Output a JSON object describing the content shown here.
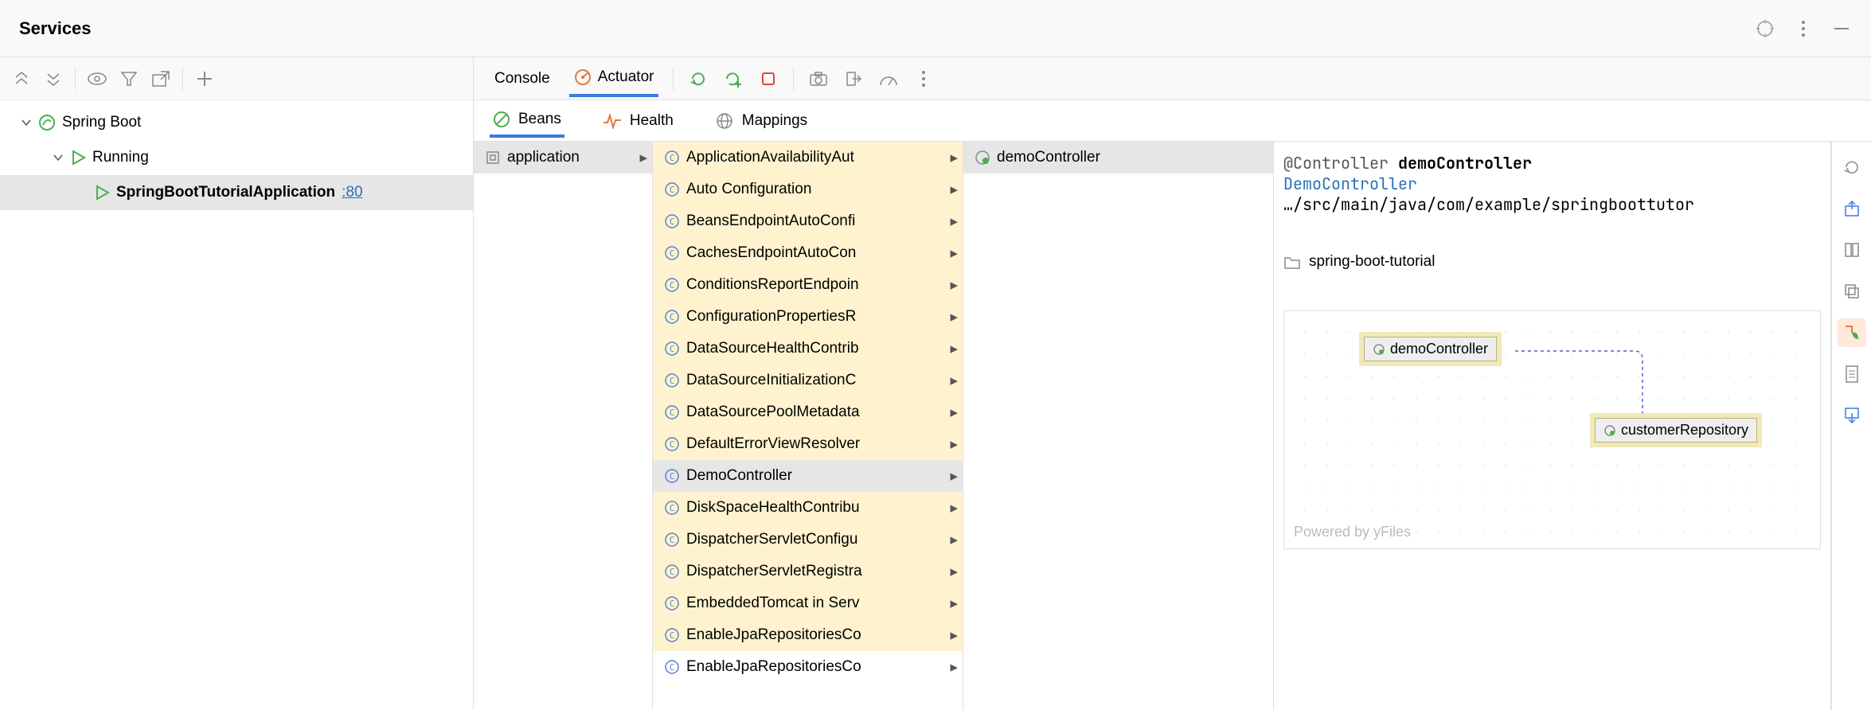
{
  "header": {
    "title": "Services"
  },
  "tree": {
    "root": {
      "label": "Spring Boot"
    },
    "running": {
      "label": "Running"
    },
    "app": {
      "label": "SpringBootTutorialApplication",
      "port": ":80"
    }
  },
  "top_tabs": {
    "console": "Console",
    "actuator": "Actuator"
  },
  "sub_tabs": {
    "beans": "Beans",
    "health": "Health",
    "mappings": "Mappings"
  },
  "app_col": {
    "label": "application"
  },
  "beans": [
    "ApplicationAvailabilityAut",
    "Auto Configuration",
    "BeansEndpointAutoConfi",
    "CachesEndpointAutoCon",
    "ConditionsReportEndpoin",
    "ConfigurationPropertiesR",
    "DataSourceHealthContrib",
    "DataSourceInitializationC",
    "DataSourcePoolMetadata",
    "DefaultErrorViewResolver",
    "DemoController",
    "DiskSpaceHealthContribu",
    "DispatcherServletConfigu",
    "DispatcherServletRegistra",
    "EmbeddedTomcat in Serv",
    "EnableJpaRepositoriesCo",
    "EnableJpaRepositoriesCo"
  ],
  "picked": {
    "label": "demoController"
  },
  "details": {
    "annotation": "@Controller",
    "name": "demoController",
    "class": "DemoController",
    "path": "…/src/main/java/com/example/springboottutor",
    "module": "spring-boot-tutorial",
    "diagram": {
      "nodeA": "demoController",
      "nodeB": "customerRepository",
      "branding": "Powered by yFiles"
    }
  }
}
